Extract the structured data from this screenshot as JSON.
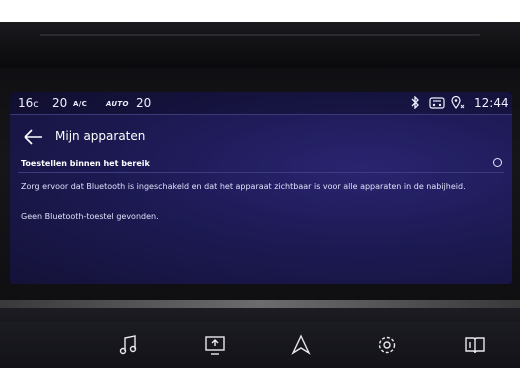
{
  "status": {
    "temp_left": "16",
    "temp_left_unit": "c",
    "temp_mid": "20",
    "ac_label": "A/C",
    "auto_label": "AUTO",
    "temp_right": "20",
    "time": "12:44"
  },
  "page": {
    "title": "Mijn apparaten"
  },
  "section": {
    "label": "Toestellen binnen het bereik"
  },
  "messages": {
    "info": "Zorg ervoor dat Bluetooth is ingeschakeld en dat het apparaat zichtbaar is voor alle apparaten in de nabijheid.",
    "empty": "Geen Bluetooth-toestel gevonden."
  },
  "icons": {
    "bluetooth": "bluetooth-icon",
    "connected_car": "connected-car-icon",
    "location": "location-icon",
    "back": "back-arrow-icon"
  },
  "bottom_buttons": [
    "music-icon",
    "phone-mirror-icon",
    "navigation-icon",
    "settings-icon",
    "manual-icon"
  ],
  "colors": {
    "screen": "#1d1a55",
    "text": "#e8e6ff"
  }
}
